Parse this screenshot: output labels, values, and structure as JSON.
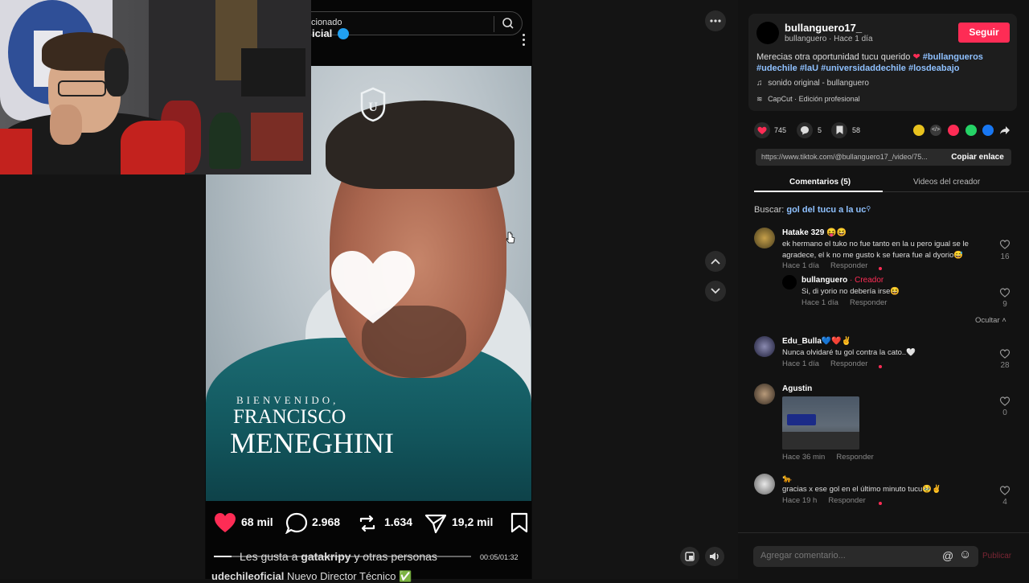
{
  "video": {
    "search_text": "cionado",
    "account_fragment": "icial",
    "poster_title_small": "BIENVENIDO,",
    "poster_first_name": "FRANCISCO",
    "poster_last_name": "MENEGHINI",
    "likes": "68 mil",
    "comments": "2.968",
    "reposts": "1.634",
    "shares": "19,2 mil",
    "liked_by_prefix": "Les gusta a",
    "liked_by_user": "gatakripy",
    "liked_by_suffix": "y otras personas",
    "time": "00:05/01:32",
    "progress_fraction": 0.07,
    "caption_user": "udechileoficial",
    "caption_text": "Nuevo Director Técnico ✅"
  },
  "post": {
    "username": "bullanguero17_",
    "meta": "bullanguero · Hace 1 día",
    "follow_label": "Seguir",
    "description_text": "Merecias otra oportunidad tucu querido ",
    "description_tags": [
      "#bullangueros",
      "#udechile",
      "#laU",
      "#universidaddechile",
      "#losdeabajo"
    ],
    "music": "sonido original - bullanguero",
    "capcut": "CapCut · Edición profesional",
    "likes": "745",
    "comments": "5",
    "saves": "58",
    "url": "https://www.tiktok.com/@bullanguero17_/video/75...",
    "copy_link_label": "Copiar enlace",
    "accent_color": "#fe2c55"
  },
  "tabs": {
    "comments": "Comentarios (5)",
    "creator_videos": "Videos del creador"
  },
  "search": {
    "label": "Buscar:",
    "query": "gol del tucu a la uc"
  },
  "comments": [
    {
      "name": "Hatake 329 😝😆",
      "text": "ek hermano el tuko no fue tanto en la u pero igual se le agradece, el k no me gusto k se fuera fue al dyorio😅",
      "time": "Hace 1 día",
      "reply": "Responder",
      "likes": "16"
    },
    {
      "name": "bullanguero",
      "creator_label": "· Creador",
      "text": "Si, di yorio no debería irse😆",
      "time": "Hace 1 día",
      "reply": "Responder",
      "likes": "9"
    },
    {
      "name": "Edu_Bulla💙❤️✌️",
      "text": "Nunca olvidaré tu gol contra la cato..🤍",
      "time": "Hace 1 día",
      "reply": "Responder",
      "likes": "28"
    },
    {
      "name": "Agustin",
      "text": "",
      "time": "Hace 36 min",
      "reply": "Responder",
      "likes": "0"
    },
    {
      "name": "🐆",
      "text": "gracias x ese gol en el último minuto tucu🥹✌️",
      "time": "Hace 19 h",
      "reply": "Responder",
      "likes": "4"
    }
  ],
  "hide_label": "Ocultar",
  "comment_input": {
    "placeholder": "Agregar comentario...",
    "publish": "Publicar"
  }
}
